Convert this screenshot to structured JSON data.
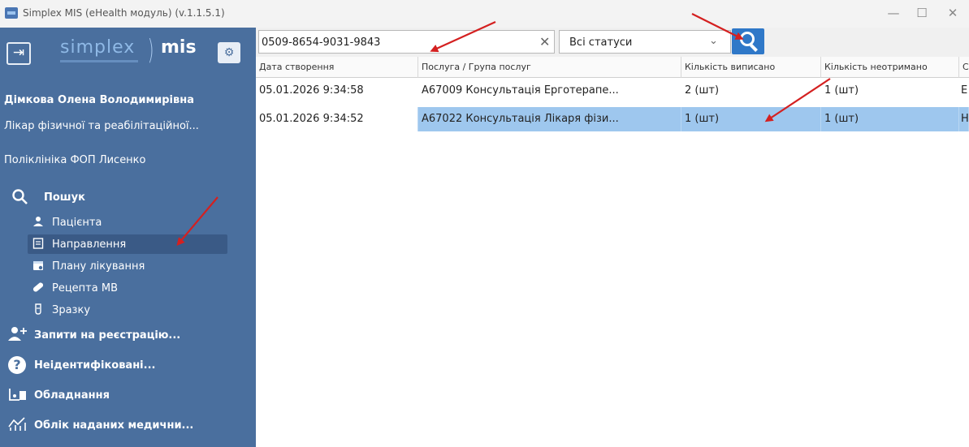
{
  "window": {
    "title": "Simplex MIS (eHealth модуль) (v.1.1.5.1)",
    "minimize": "—",
    "maximize": "☐",
    "close": "✕"
  },
  "sidebar": {
    "logo_left": "simplex",
    "logo_bracket": ")",
    "logo_right": "mis",
    "logout_icon": "⇥",
    "settings_icon": "⚙",
    "user_name": "Дімкова Олена Володимирівна",
    "user_role": "Лікар фізичної та реабілітаційної...",
    "clinic": "Поліклініка ФОП Лисенко",
    "search_section": {
      "label": "Пошук",
      "icon": "search-icon"
    },
    "search_items": [
      {
        "label": "Пацієнта",
        "icon": "user-icon",
        "active": false
      },
      {
        "label": "Направлення",
        "icon": "document-icon",
        "active": true
      },
      {
        "label": "Плану лікування",
        "icon": "calendar-icon",
        "active": false
      },
      {
        "label": "Рецепта МВ",
        "icon": "pill-icon",
        "active": false
      },
      {
        "label": "Зразку",
        "icon": "tube-icon",
        "active": false
      }
    ],
    "main_items": [
      {
        "label": "Запити на реєстрацію...",
        "icon": "add-user-icon"
      },
      {
        "label": "Неідентифіковані...",
        "icon": "question-icon"
      },
      {
        "label": "Обладнання",
        "icon": "equipment-icon"
      },
      {
        "label": "Облік наданих медични...",
        "icon": "chart-icon"
      }
    ]
  },
  "toolbar": {
    "search_value": "0509-8654-9031-9843",
    "clear_icon": "✕",
    "status_value": "Всі статуси",
    "status_chevron": "⌄"
  },
  "table": {
    "columns": [
      "Дата створення",
      "Послуга / Група послуг",
      "Кількість виписано",
      "Кількість неотримано",
      "С"
    ],
    "rows": [
      {
        "cells": [
          "05.01.2026 9:34:58",
          "А67009 Консультація Ерготерапе...",
          "2 (шт)",
          "1 (шт)",
          "Е"
        ],
        "selected": false
      },
      {
        "cells": [
          "05.01.2026 9:34:52",
          "А67022 Консультація Лікаря фізи...",
          "1 (шт)",
          "1 (шт)",
          "Н"
        ],
        "selected": true
      }
    ]
  },
  "colors": {
    "sidebar_bg": "#4a6f9e",
    "selected_row": "#9ec7ee",
    "search_button": "#2f78c8",
    "annotation_arrow": "#d42020"
  }
}
